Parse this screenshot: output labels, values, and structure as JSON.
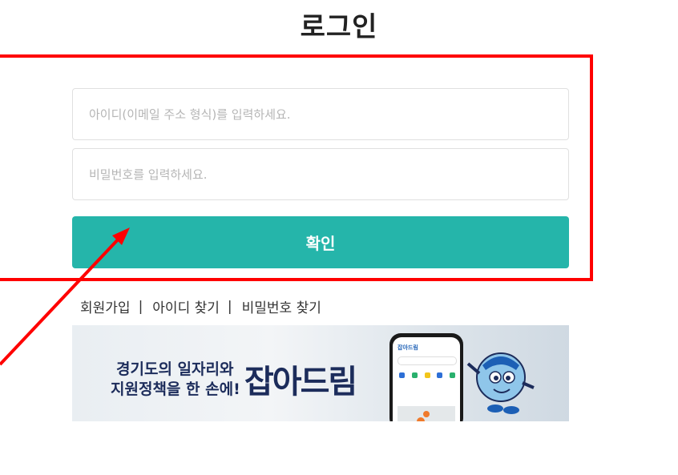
{
  "page": {
    "title": "로그인"
  },
  "form": {
    "id_placeholder": "아이디(이메일 주소 형식)를 입력하세요.",
    "pw_placeholder": "비밀번호를 입력하세요.",
    "confirm_label": "확인"
  },
  "links": {
    "signup": "회원가입",
    "find_id": "아이디 찾기",
    "find_pw": "비밀번호 찾기",
    "separator": "|"
  },
  "banner": {
    "line1_prefix": "경기도의 ",
    "line1_highlight": "일자리와",
    "line2_prefix": "지원정책을 ",
    "line2_suffix": "한 손에!",
    "brand": "잡아드림",
    "phone_brand": "잡아드림"
  },
  "colors": {
    "accent": "#25b5aa",
    "highlight_border": "#ff0000",
    "brand_navy": "#1c2c5b"
  }
}
